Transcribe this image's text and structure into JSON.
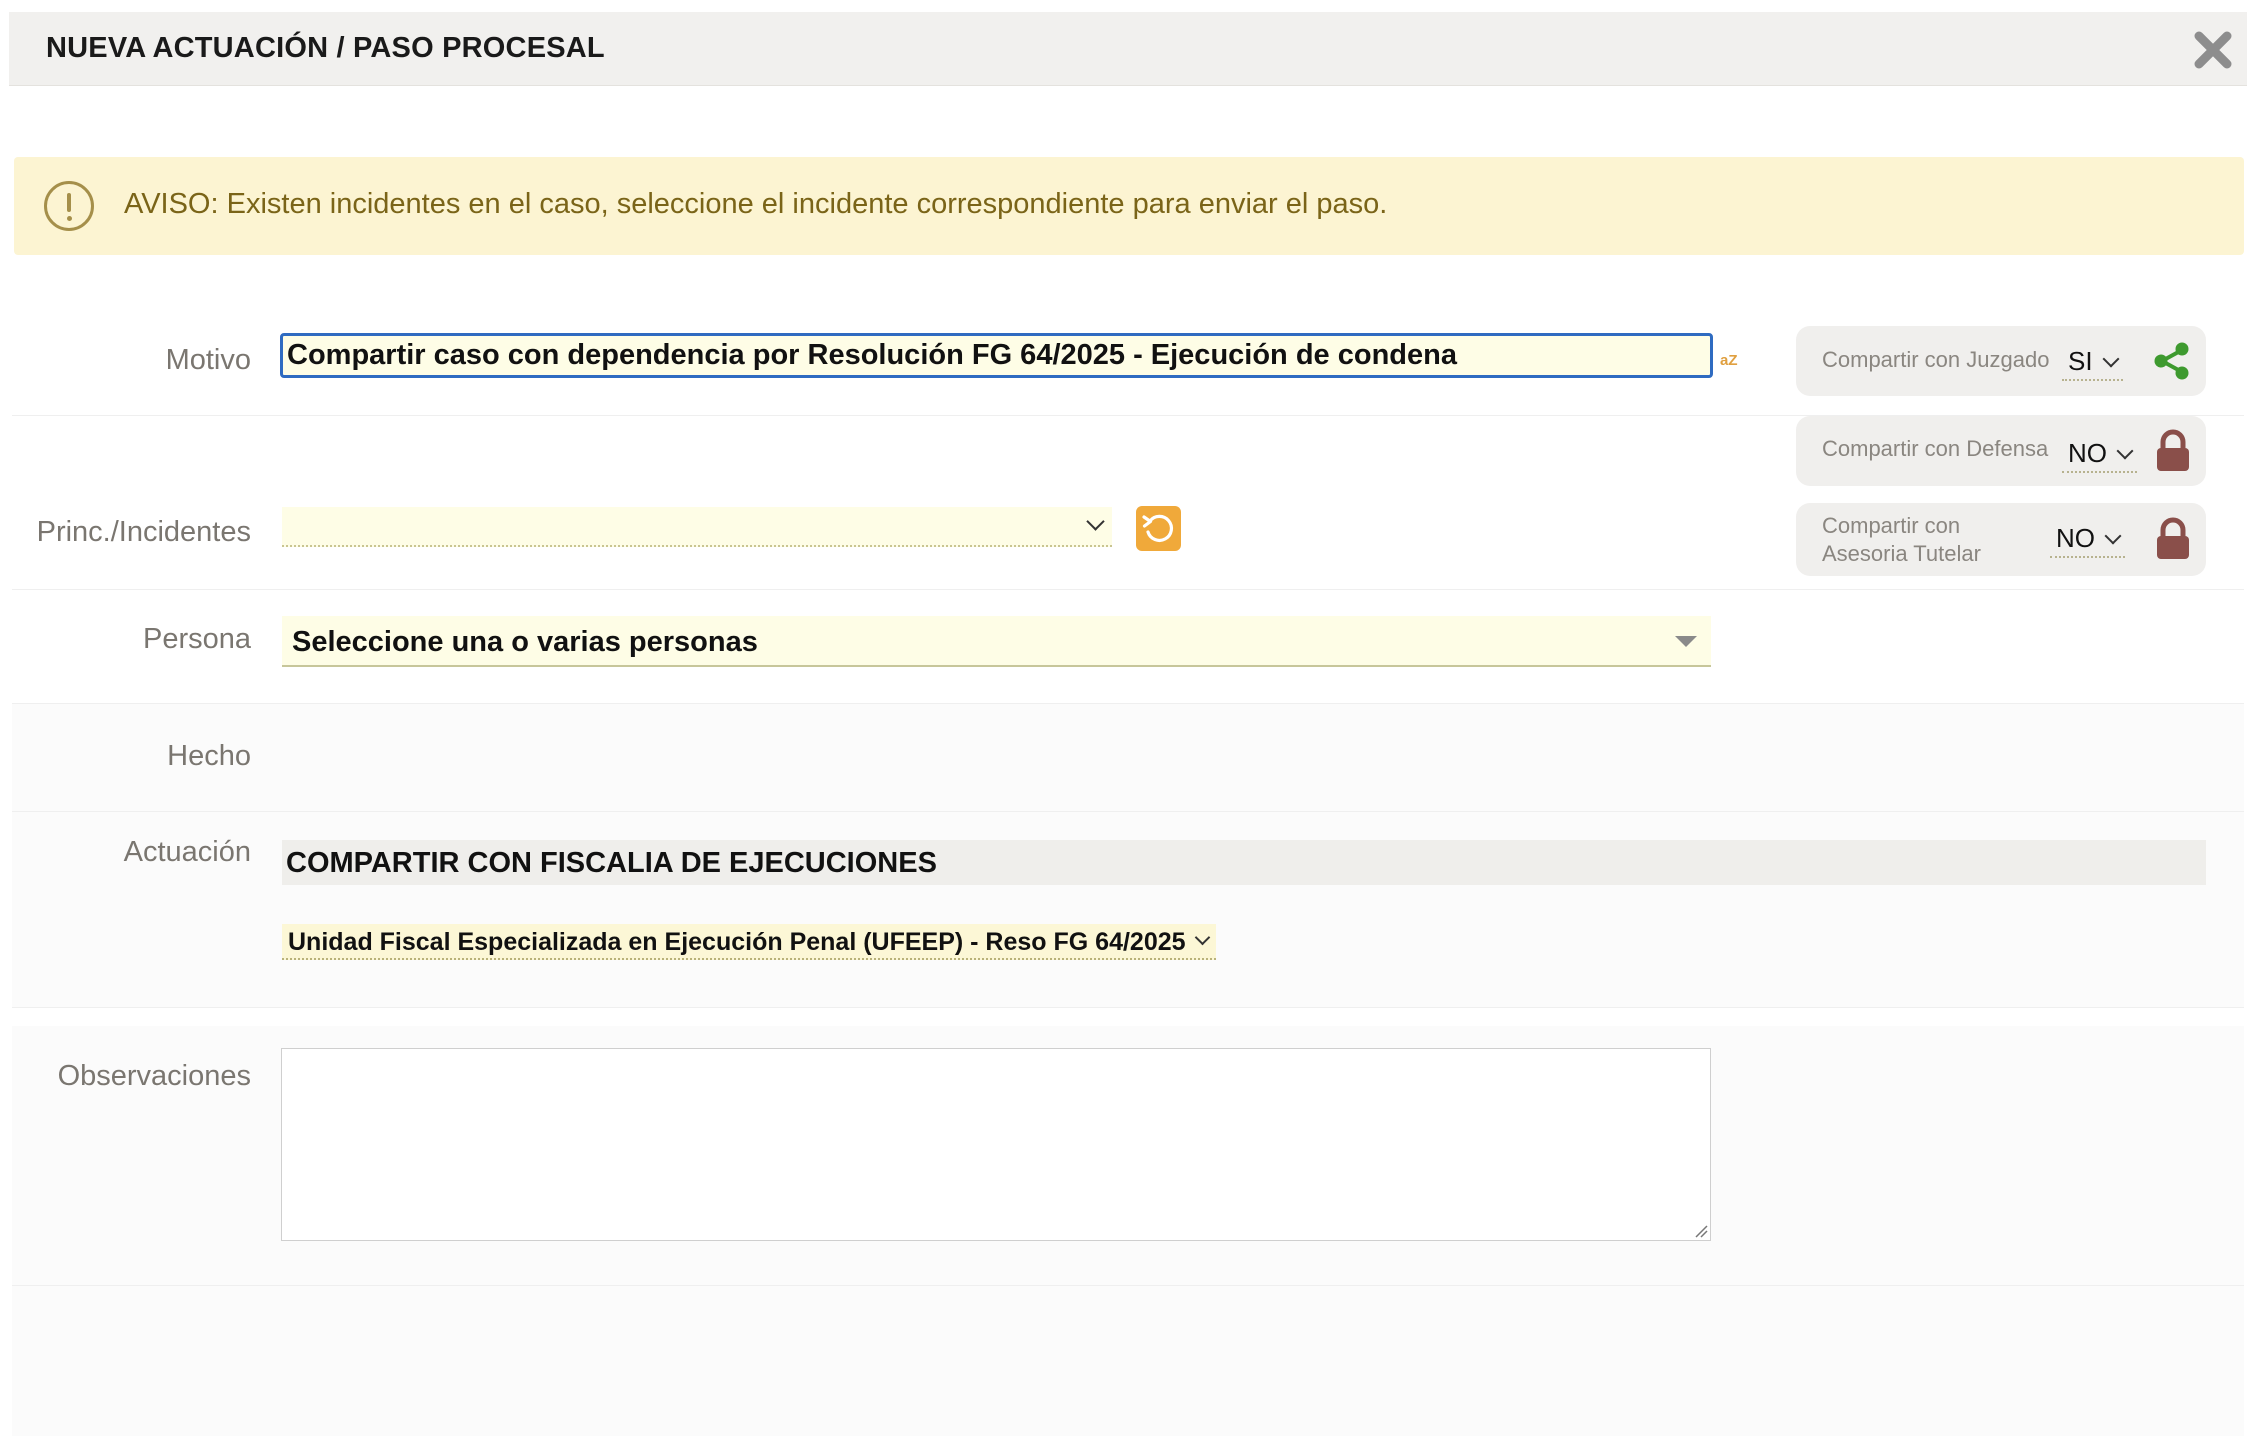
{
  "header": {
    "title": "NUEVA ACTUACIÓN / PASO PROCESAL",
    "close_icon": "close-x-icon"
  },
  "warning": {
    "icon": "exclamation-circle-icon",
    "text": "AVISO: Existen incidentes en el caso, seleccione el incidente correspondiente para enviar el paso."
  },
  "form": {
    "motivo": {
      "label": "Motivo",
      "value": "Compartir caso con dependencia por Resolución FG 64/2025 - Ejecución de condena",
      "sort_icon_text": "aZ"
    },
    "incidentes": {
      "label": "Princ./Incidentes",
      "value": ""
    },
    "persona": {
      "label": "Persona",
      "placeholder": "Seleccione una o varias personas"
    },
    "hecho": {
      "label": "Hecho"
    },
    "actuacion": {
      "label": "Actuación",
      "value": "COMPARTIR CON FISCALIA DE EJECUCIONES",
      "unidad": "Unidad Fiscal Especializada en Ejecución Penal (UFEEP) - Reso FG 64/2025"
    },
    "observaciones": {
      "label": "Observaciones",
      "value": ""
    }
  },
  "share": {
    "juzgado": {
      "label": "Compartir con Juzgado",
      "value": "SI",
      "icon": "share-icon",
      "icon_color": "#3e9a2f"
    },
    "defensa": {
      "label": "Compartir con Defensa",
      "value": "NO",
      "icon": "lock-icon",
      "icon_color": "#8a4f4a"
    },
    "asesoria": {
      "label_line1": "Compartir con",
      "label_line2": "Asesoria Tutelar",
      "value": "NO",
      "icon": "lock-icon",
      "icon_color": "#8a4f4a"
    }
  },
  "colors": {
    "accent_blue": "#2f6bc1",
    "warning_bg": "#fcf4d2",
    "warning_text": "#7a6418",
    "refresh_orange": "#f0a93a",
    "field_bg": "#fefde6"
  }
}
